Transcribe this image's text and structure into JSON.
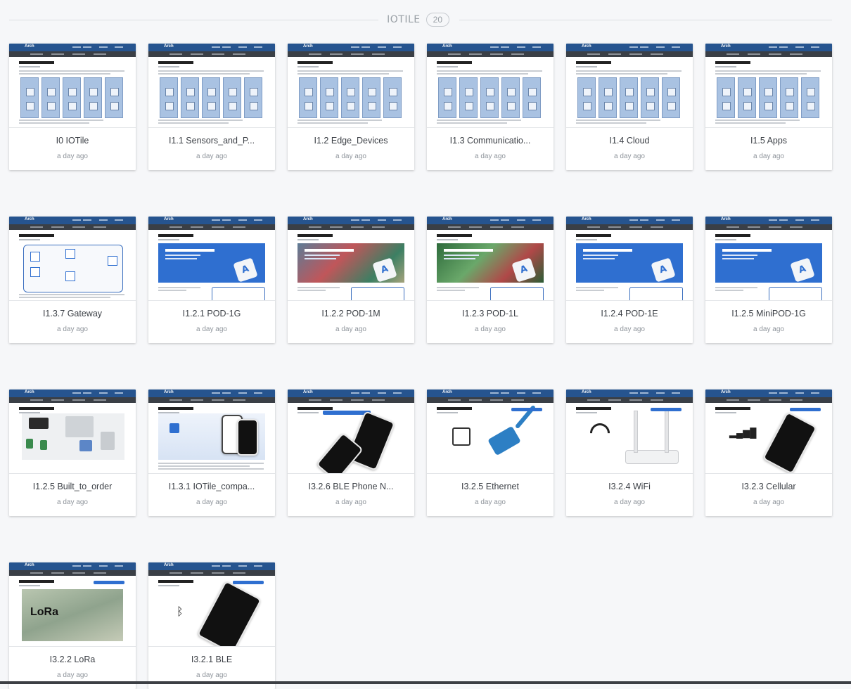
{
  "section": {
    "title": "IOTILE",
    "count": "20"
  },
  "cards": [
    {
      "title": "I0 IOTile",
      "time": "a day ago",
      "thumb": "panels",
      "heading": "IOTile™"
    },
    {
      "title": "I1.1 Sensors_and_P...",
      "time": "a day ago",
      "thumb": "panels",
      "heading": "Sensors and Protocols"
    },
    {
      "title": "I1.2 Edge_Devices",
      "time": "a day ago",
      "thumb": "panels",
      "heading": "Edge Devices"
    },
    {
      "title": "I1.3 Communicatio...",
      "time": "a day ago",
      "thumb": "panels",
      "heading": "Communication Tools"
    },
    {
      "title": "I1.4 Cloud",
      "time": "a day ago",
      "thumb": "panels",
      "heading": "Cloud"
    },
    {
      "title": "I1.5 Apps",
      "time": "a day ago",
      "thumb": "panels",
      "heading": "Apps"
    },
    {
      "title": "I1.3.7 Gateway",
      "time": "a day ago",
      "thumb": "diagram",
      "heading": "Gateway"
    },
    {
      "title": "I1.2.1 POD-1G",
      "time": "a day ago",
      "thumb": "banner",
      "heading": "General Purpose"
    },
    {
      "title": "I1.2.2 POD-1M",
      "time": "a day ago",
      "thumb": "photo",
      "heading": "Shipping Tracker"
    },
    {
      "title": "I1.2.3 POD-1L",
      "time": "a day ago",
      "thumb": "green",
      "heading": "Light Sensor Logger"
    },
    {
      "title": "I1.2.4 POD-1E",
      "time": "a day ago",
      "thumb": "banner",
      "heading": "Environmental Health"
    },
    {
      "title": "I1.2.5 MiniPOD-1G",
      "time": "a day ago",
      "thumb": "banner",
      "heading": "miniTemp Logger"
    },
    {
      "title": "I1.2.5 Built_to_order",
      "time": "a day ago",
      "thumb": "built",
      "heading": "Built-to-Order"
    },
    {
      "title": "I1.3.1 IOTile_compa...",
      "time": "a day ago",
      "thumb": "app",
      "heading": "IOTile Companion App"
    },
    {
      "title": "I3.2.6 BLE Phone N...",
      "time": "a day ago",
      "thumb": "phones",
      "heading": "BLE Phone Network"
    },
    {
      "title": "I3.2.5 Ethernet",
      "time": "a day ago",
      "thumb": "ethernet",
      "heading": "Ethernet"
    },
    {
      "title": "I3.2.4 WiFi",
      "time": "a day ago",
      "thumb": "wifi",
      "heading": "Wi-Fi"
    },
    {
      "title": "I3.2.3 Cellular",
      "time": "a day ago",
      "thumb": "cellular",
      "heading": "Cellular"
    },
    {
      "title": "I3.2.2 LoRa",
      "time": "a day ago",
      "thumb": "lora",
      "heading": "LoRa (Long Range RF)"
    },
    {
      "title": "I3.2.1 BLE",
      "time": "a day ago",
      "thumb": "ble",
      "heading": "Bluetooth Low Energy (BLE)"
    }
  ],
  "thumb_text": {
    "logo": "Arch",
    "lora_word": "LoRa",
    "ble_symbol": "ᛒ",
    "wifi_symbol": "Wi-Fi",
    "cell_symbol": "▂▄▆█"
  }
}
